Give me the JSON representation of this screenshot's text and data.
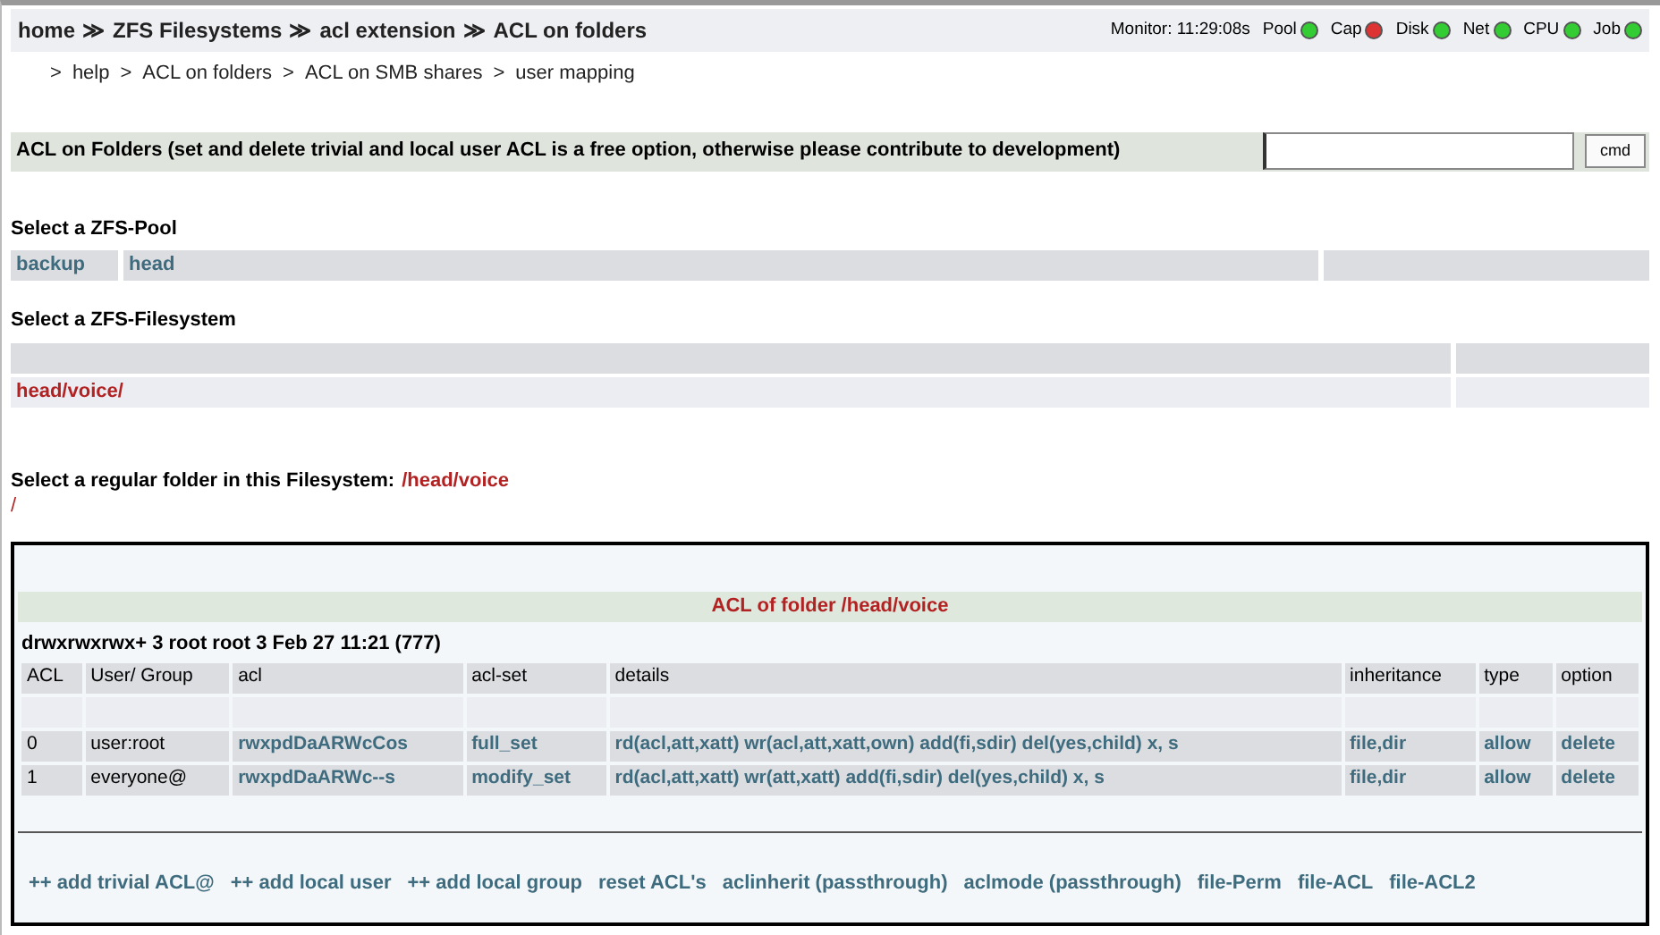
{
  "breadcrumb": [
    {
      "label": "home"
    },
    {
      "sep": "≫",
      "label": "ZFS Filesystems"
    },
    {
      "sep": "≫",
      "label": "acl extension"
    },
    {
      "sep": "≫",
      "label": "ACL on folders"
    }
  ],
  "monitor": {
    "label": "Monitor: 11:29:08s",
    "indicators": [
      {
        "label": "Pool",
        "color": "#33cc33"
      },
      {
        "label": "Cap",
        "color": "#dd3333"
      },
      {
        "label": "Disk",
        "color": "#33cc33"
      },
      {
        "label": "Net",
        "color": "#33cc33"
      },
      {
        "label": "CPU",
        "color": "#33cc33"
      },
      {
        "label": "Job",
        "color": "#33cc33"
      }
    ]
  },
  "sub_nav": [
    {
      "sep": ">",
      "label": "help"
    },
    {
      "sep": ">",
      "label": "ACL on folders"
    },
    {
      "sep": ">",
      "label": "ACL on SMB shares"
    },
    {
      "sep": ">",
      "label": "user mapping"
    }
  ],
  "title_bar": {
    "title": "ACL on Folders (set and delete trivial and local user ACL is a free option, otherwise please contribute to development)",
    "command_button": "cmd"
  },
  "pool_section": {
    "heading": "Select a ZFS-Pool",
    "pools": [
      "backup",
      "head"
    ]
  },
  "filesystem_section": {
    "heading": "Select a ZFS-Filesystem",
    "filesystems": [
      "head/voice/"
    ]
  },
  "folder_section": {
    "heading": "Select a regular folder in this Filesystem:",
    "path": "/head/voice",
    "folders": [
      "/"
    ]
  },
  "acl_panel": {
    "title": "ACL of folder /head/voice",
    "listing": "drwxrwxrwx+ 3 root root 3 Feb 27 11:21 (777)",
    "columns": [
      "ACL",
      "User/ Group",
      "acl",
      "acl-set",
      "details",
      "inheritance",
      "type",
      "option"
    ],
    "rows": [
      [
        "0",
        "user:root",
        "rwxpdDaARWcCos",
        "full_set",
        "rd(acl,att,xatt) wr(acl,att,xatt,own) add(fi,sdir) del(yes,child) x, s",
        "file,dir",
        "allow",
        "delete"
      ],
      [
        "1",
        "everyone@",
        "rwxpdDaARWc--s",
        "modify_set",
        "rd(acl,att,xatt) wr(att,xatt) add(fi,sdir) del(yes,child) x, s",
        "file,dir",
        "allow",
        "delete"
      ]
    ],
    "actions": [
      "++ add trivial ACL@",
      "++ add local user",
      "++ add local group",
      "reset ACL's",
      "aclinherit (passthrough)",
      "aclmode (passthrough)",
      "file-Perm",
      "file-ACL",
      "file-ACL2"
    ]
  }
}
